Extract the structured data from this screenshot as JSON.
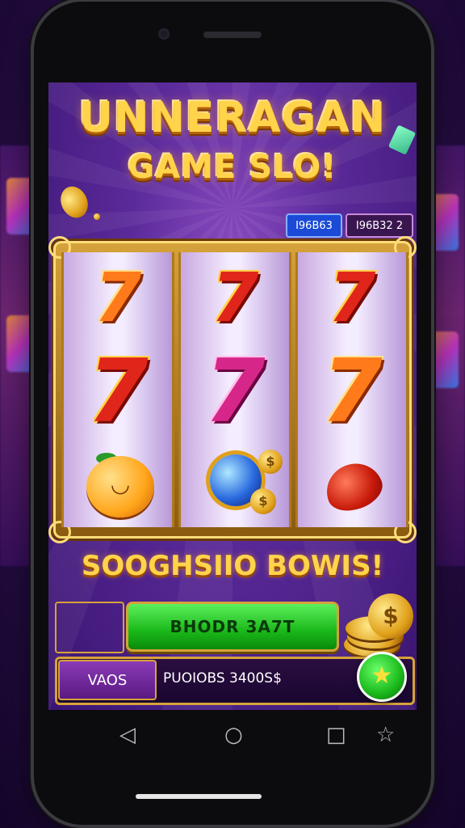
{
  "header": {
    "title_line1": "UNNERAGAN",
    "title_line2": "GAME SLO!"
  },
  "counters": {
    "left": "I96B63",
    "right": "I96B32 2"
  },
  "reels": [
    {
      "top": "7",
      "middle": "7",
      "bottom": "orange-fruit"
    },
    {
      "top": "7",
      "middle": "7",
      "bottom": "globe-with-coins"
    },
    {
      "top": "7",
      "middle": "7",
      "bottom": "red-lips"
    }
  ],
  "bonus": {
    "text": "SOOGHSIIO BOWIS!"
  },
  "spin_button": {
    "label": "BHODR 3A7T"
  },
  "bottom_panel": {
    "tab_label": "VAOS",
    "balance_text": "PUOIOBS 3400S$"
  },
  "coin_symbol": "$",
  "nav": {
    "back": "◁",
    "home": "○",
    "recents": "□",
    "extra": "☆"
  },
  "colors": {
    "gold": "#ffd34a",
    "spin_green": "#1ab81a",
    "counter_blue": "#1a4ad6",
    "panel_purple": "#5a1a80"
  }
}
